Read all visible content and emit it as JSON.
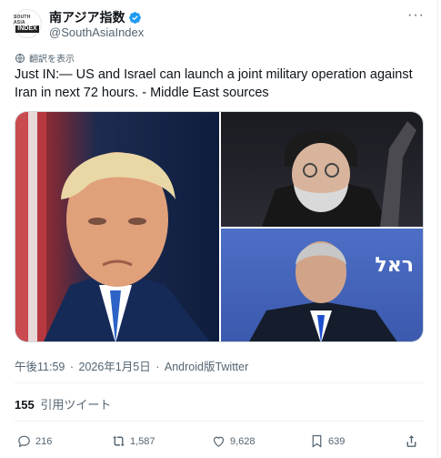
{
  "author": {
    "display_name": "南アジア指数",
    "handle": "@SouthAsiaIndex",
    "logo_top": "SOUTH ASIA",
    "logo_bottom": "INDEX"
  },
  "translate_label": "翻訳を表示",
  "tweet_text": "Just IN:— US and Israel can launch a joint military operation against Iran in next 72 hours. - Middle East sources",
  "image_overlay_text": "ראל",
  "meta": {
    "time": "午後11:59",
    "sep": "·",
    "date": "2026年1月5日",
    "source": "Android版Twitter"
  },
  "quotes": {
    "count": "155",
    "label": "引用ツイート"
  },
  "actions": {
    "replies": "216",
    "retweets": "1,587",
    "likes": "9,628",
    "bookmarks": "639"
  },
  "colors": {
    "verified": "#1d9bf0",
    "secondary_text": "#536471"
  }
}
